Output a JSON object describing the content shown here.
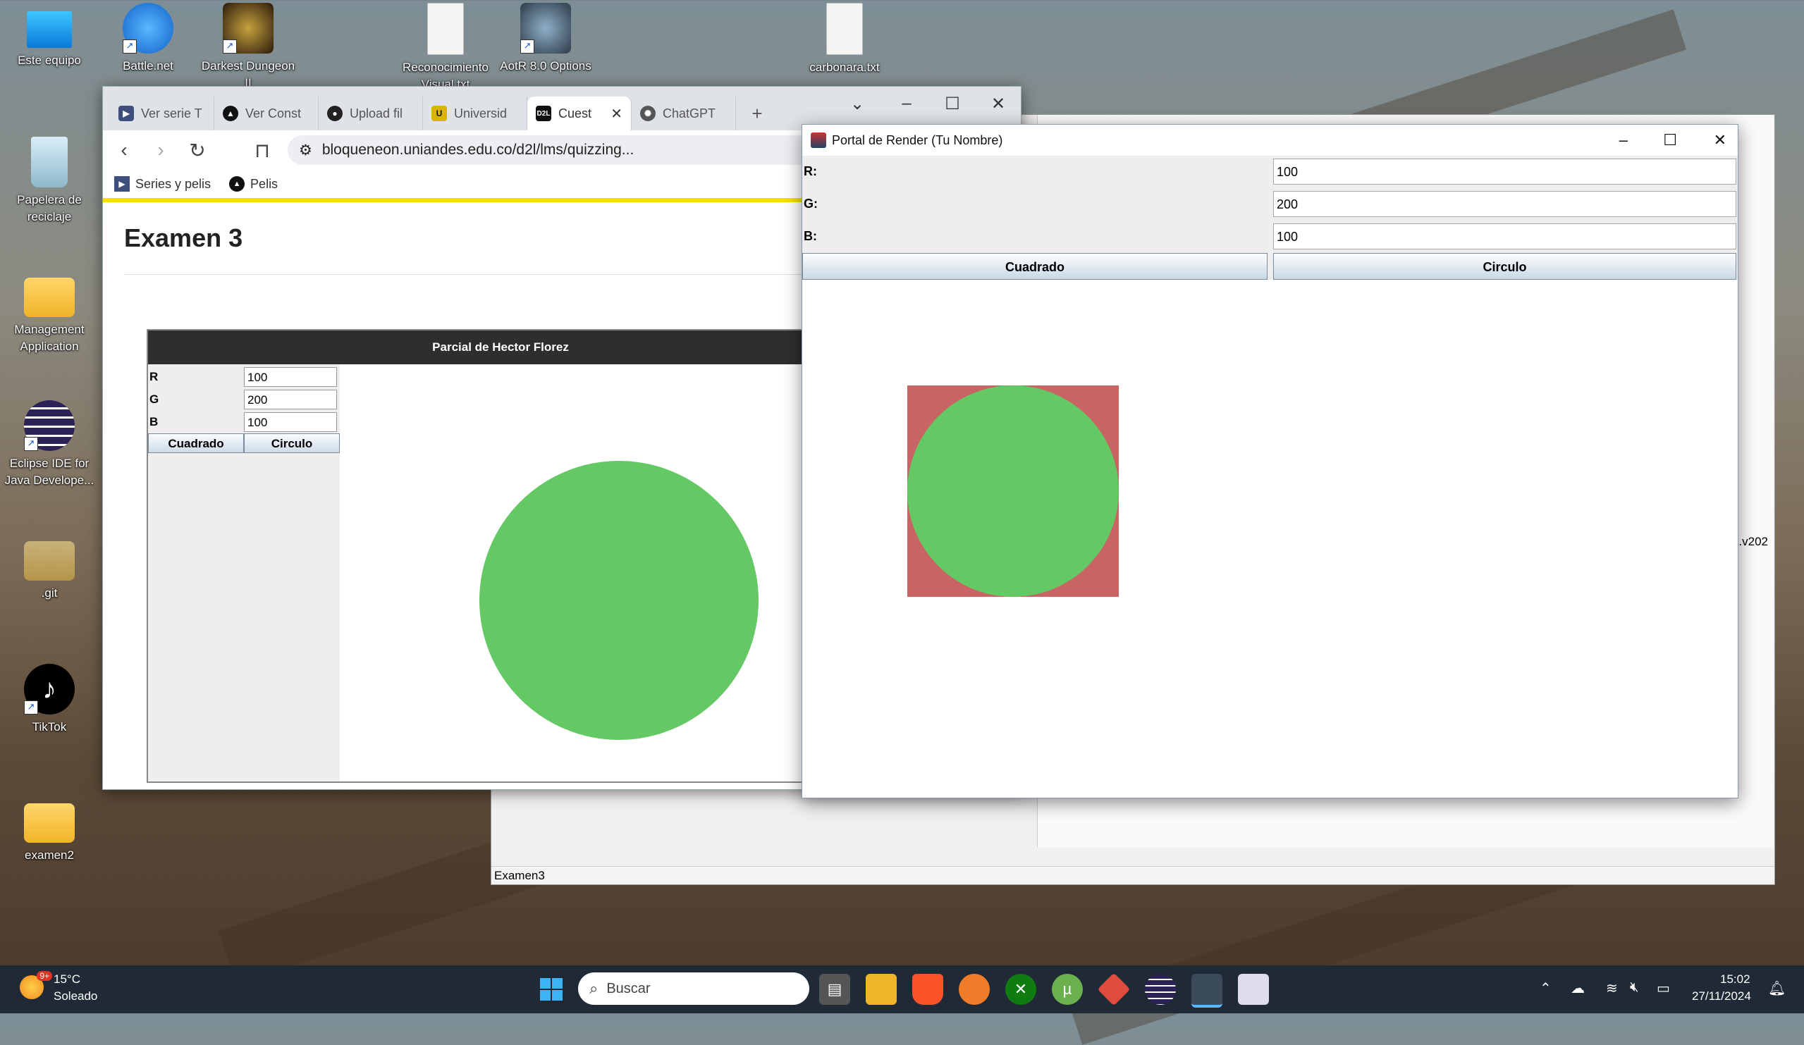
{
  "desktop": {
    "icons": [
      {
        "label": "Este equipo",
        "icon": "monitor-icon"
      },
      {
        "label": "Battle.net",
        "icon": "battlenet-icon"
      },
      {
        "label": "Darkest Dungeon II",
        "icon": "game-icon"
      },
      {
        "label": "Reconocimiento Visual.txt",
        "icon": "text-file-icon"
      },
      {
        "label": "AotR 8.0 Options",
        "icon": "app-icon"
      },
      {
        "label": "carbonara.txt",
        "icon": "text-file-icon"
      },
      {
        "label": "Papelera de reciclaje",
        "icon": "recycle-bin-icon"
      },
      {
        "label": "Management Application",
        "icon": "folder-icon"
      },
      {
        "label": "Eclipse IDE for Java Develope...",
        "icon": "eclipse-icon"
      },
      {
        "label": ".git",
        "icon": "folder-icon"
      },
      {
        "label": "TikTok",
        "icon": "tiktok-icon"
      },
      {
        "label": "examen2",
        "icon": "folder-icon"
      }
    ]
  },
  "browser": {
    "tabs": [
      {
        "label": "Ver serie T",
        "icon": "play-icon",
        "color": "#3d4f7a"
      },
      {
        "label": "Ver Const",
        "icon": "triangle-icon",
        "color": "#111111"
      },
      {
        "label": "Upload fil",
        "icon": "github-icon",
        "color": "#222222"
      },
      {
        "label": "Universid",
        "icon": "university-icon",
        "color": "#d9b300"
      },
      {
        "label": "Cuest",
        "icon": "d2l-icon",
        "color": "#111111",
        "active": true
      },
      {
        "label": "ChatGPT",
        "icon": "chatgpt-icon",
        "color": "#555555"
      }
    ],
    "url": "bloqueneon.uniandes.edu.co/d2l/lms/quizzing...",
    "bookmarks": [
      {
        "label": "Series y pelis",
        "icon": "play-icon"
      },
      {
        "label": "Pelis",
        "icon": "triangle-icon"
      }
    ],
    "page_title": "Examen 3",
    "embedded": {
      "title": "Parcial de Hector Florez",
      "r_label": "R",
      "g_label": "G",
      "b_label": "B",
      "r_value": "100",
      "g_value": "200",
      "b_value": "100",
      "square_button": "Cuadrado",
      "circle_button": "Circulo",
      "circle_color": "#64c864"
    }
  },
  "java_back": {
    "status": "Examen3",
    "version_text": "2.v202"
  },
  "portal": {
    "title": "Portal de Render (Tu Nombre)",
    "r_label": "R:",
    "g_label": "G:",
    "b_label": "B:",
    "r_value": "100",
    "g_value": "200",
    "b_value": "100",
    "square_button": "Cuadrado",
    "circle_button": "Circulo",
    "square_color": "#c86464",
    "circle_color": "#64c864"
  },
  "taskbar": {
    "weather_temp": "15°C",
    "weather_desc": "Soleado",
    "weather_badge": "9+",
    "search_placeholder": "Buscar",
    "time": "15:02",
    "date": "27/11/2024"
  }
}
